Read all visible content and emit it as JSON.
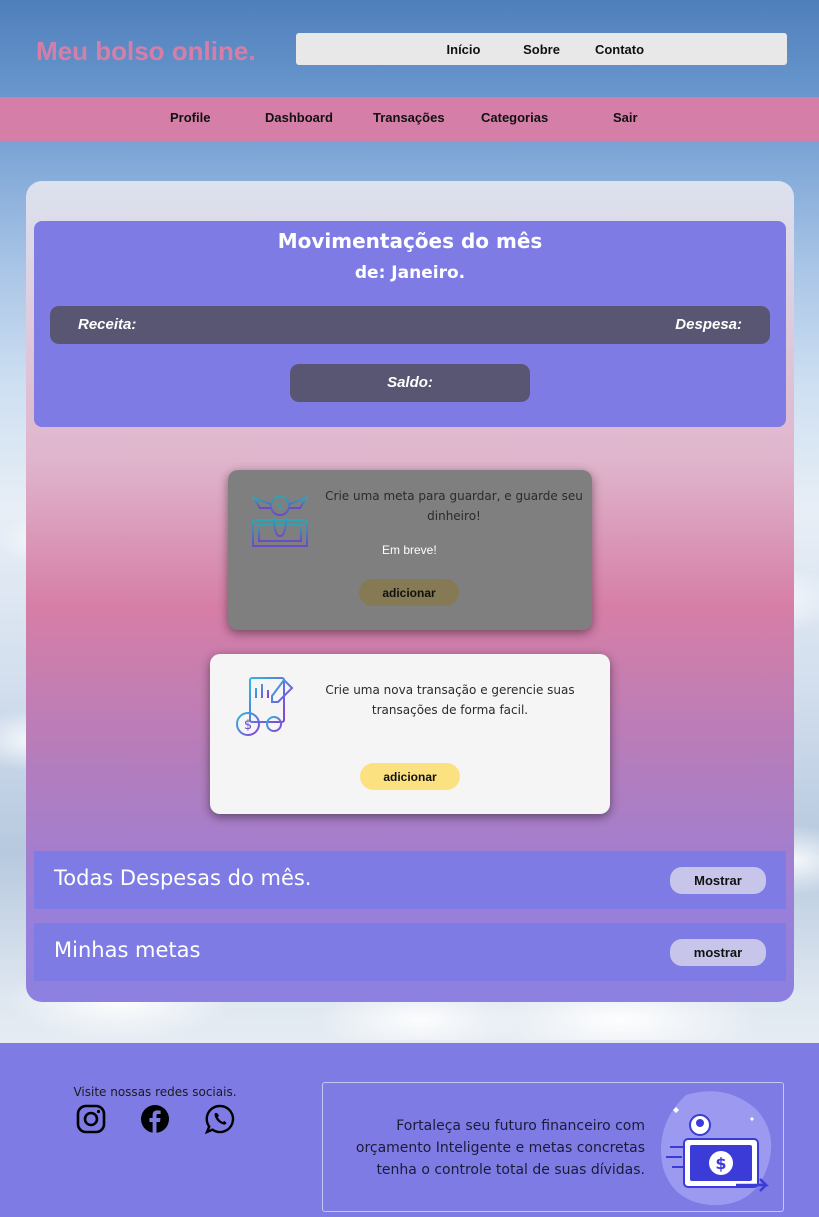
{
  "header": {
    "logo": "Meu bolso online.",
    "topnav": [
      "Início",
      "Sobre",
      "Contato"
    ]
  },
  "mainnav": [
    "Profile",
    "Dashboard",
    "Transações",
    "Categorias",
    "Sair"
  ],
  "movimentacoes": {
    "title": "Movimentações do mês",
    "subtitle": "de: Janeiro.",
    "receita_label": "Receita:",
    "despesa_label": "Despesa:",
    "saldo_label": "Saldo:"
  },
  "cards": {
    "meta": {
      "text": "Crie uma meta para guardar, e guarde seu dinheiro!",
      "status": "Em breve!",
      "button": "adicionar",
      "icon": "money-saving-icon"
    },
    "transacao": {
      "text": "Crie uma nova transação e gerencie suas transações de forma facil.",
      "button": "adicionar",
      "icon": "finance-report-icon"
    }
  },
  "sections": {
    "despesas": {
      "title": "Todas Despesas do mês.",
      "button": "Mostrar"
    },
    "metas": {
      "title": "Minhas metas",
      "button": "mostrar"
    }
  },
  "footer": {
    "social_text": "Visite nossas redes sociais.",
    "social_icons": [
      "instagram-icon",
      "facebook-icon",
      "whatsapp-icon"
    ],
    "promo_text": "Fortaleça seu futuro financeiro com orçamento Inteligente e metas concretas tenha o controle total de suas dívidas."
  },
  "colors": {
    "accent_pink": "#d57fa8",
    "accent_purple": "#7e7ce4",
    "dark_bar": "#585673",
    "button_yellow": "#fbe17f"
  }
}
